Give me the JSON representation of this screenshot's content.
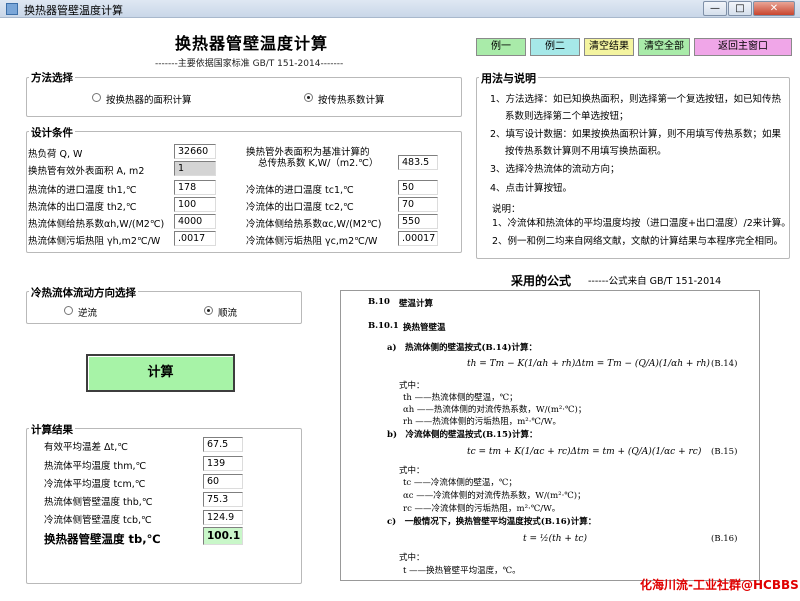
{
  "window": {
    "title": "换热器管壁温度计算",
    "min_glyph": "—",
    "max_glyph": "□",
    "close_glyph": "✕"
  },
  "header": {
    "title": "换热器管壁温度计算",
    "subtitle": "-------主要依据国家标准 GB/T 151-2014-------"
  },
  "toolbar": {
    "example1": "例一",
    "example2": "例二",
    "clear_results": "清空结果",
    "clear_all": "清空全部",
    "back_main": "返回主窗口"
  },
  "method": {
    "title": "方法选择",
    "option_area": "按换热器的面积计算",
    "option_coef": "按传热系数计算",
    "selected": "option_coef"
  },
  "design": {
    "title": "设计条件",
    "left": [
      {
        "label": "热负荷 Q, W",
        "value": "32660",
        "readonly": false
      },
      {
        "label": "换热管有效外表面积 A, m2",
        "value": "1",
        "readonly": true
      },
      {
        "label": "热流体的进口温度 th1,℃",
        "value": "178",
        "readonly": false
      },
      {
        "label": "热流体的出口温度 th2,℃",
        "value": "100",
        "readonly": false
      },
      {
        "label": "热流体侧给热系数αh,W/(M2℃)",
        "value": "4000",
        "readonly": false
      },
      {
        "label": "热流体侧污垢热阻 γh,m2℃/W",
        "value": ".0017",
        "readonly": false
      }
    ],
    "k_label_line1": "换热管外表面积为基准计算的",
    "k_label_line2": "总传热系数 K,W/（m2.℃）",
    "k_value": "483.5",
    "right": [
      {
        "label": "冷流体的进口温度 tc1,℃",
        "value": "50"
      },
      {
        "label": "冷流体的出口温度 tc2,℃",
        "value": "70"
      },
      {
        "label": "冷流体侧给热系数αc,W/(M2℃)",
        "value": "550"
      },
      {
        "label": "冷流体侧污垢热阻 γc,m2℃/W",
        "value": ".00017"
      }
    ]
  },
  "flow": {
    "title": "冷热流体流动方向选择",
    "counter": "逆流",
    "parallel": "顺流",
    "selected": "parallel"
  },
  "calc_button": "计算",
  "results": {
    "title": "计算结果",
    "items": [
      {
        "label": "有效平均温差 Δt,℃",
        "value": "67.5"
      },
      {
        "label": "热流体平均温度 thm,℃",
        "value": "139"
      },
      {
        "label": "冷流体平均温度 tcm,℃",
        "value": "60"
      },
      {
        "label": "热流体侧管壁温度 thb,℃",
        "value": "75.3"
      },
      {
        "label": "冷流体侧管壁温度 tcb,℃",
        "value": "124.9"
      }
    ],
    "final_label": "换热器管壁温度 tb,℃",
    "final_value": "100.1"
  },
  "usage": {
    "title": "用法与说明",
    "lines": [
      "1、方法选择：如已知换热面积，则选择第一个复选按钮，如已知传热",
      "系数则选择第二个单选按钮；",
      "2、填写设计数据：如果按换热面积计算，则不用填写传热系数；如果",
      "按传热系数计算则不用填写换热面积。",
      "3、选择冷热流体的流动方向；",
      "4、点击计算按钮。"
    ],
    "note_title": "说明：",
    "notes": [
      "1、冷流体和热流体的平均温度均按（进口温度+出口温度）/2来计算。",
      "2、例一和例二均来自网络文献，文献的计算结果与本程序完全相同。"
    ]
  },
  "formula": {
    "heading": "采用的公式",
    "source": "------公式来自 GB/T 151-2014",
    "sec": "B.10",
    "sec_title": "壁温计算",
    "subsec": "B.10.1",
    "subsec_title": "换热管壁温",
    "a_text": "a)　热流体侧的壁温按式(B.14)计算：",
    "eq14": "th = Tm − K(1/αh + rh)Δtm = Tm − (Q/A)(1/αh + rh)",
    "eq14_no": "(B.14)",
    "where1": "式中：",
    "a_defs": [
      "th ——热流体侧的壁温，℃；",
      "αh ——热流体侧的对流传热系数，W/(m²·℃)；",
      "rh ——热流体侧的污垢热阻，m²·℃/W。"
    ],
    "b_text": "b)　冷流体侧的壁温按式(B.15)计算：",
    "eq15": "tc = tm + K(1/αc + rc)Δtm = tm + (Q/A)(1/αc + rc)",
    "eq15_no": "(B.15)",
    "where2": "式中：",
    "b_defs": [
      "tc ——冷流体侧的壁温，℃；",
      "αc ——冷流体侧的对流传热系数，W/(m²·℃)；",
      "rc ——冷流体侧的污垢热阻，m²·℃/W。"
    ],
    "c_text": "c)　一般情况下，换热管壁平均温度按式(B.16)计算：",
    "eq16": "t = ½(th + tc)",
    "eq16_no": "(B.16)",
    "where3": "式中：",
    "c_defs": [
      "t ——换热管壁平均温度，℃。"
    ]
  },
  "watermark": "化海川流-工业社群@HCBBS"
}
